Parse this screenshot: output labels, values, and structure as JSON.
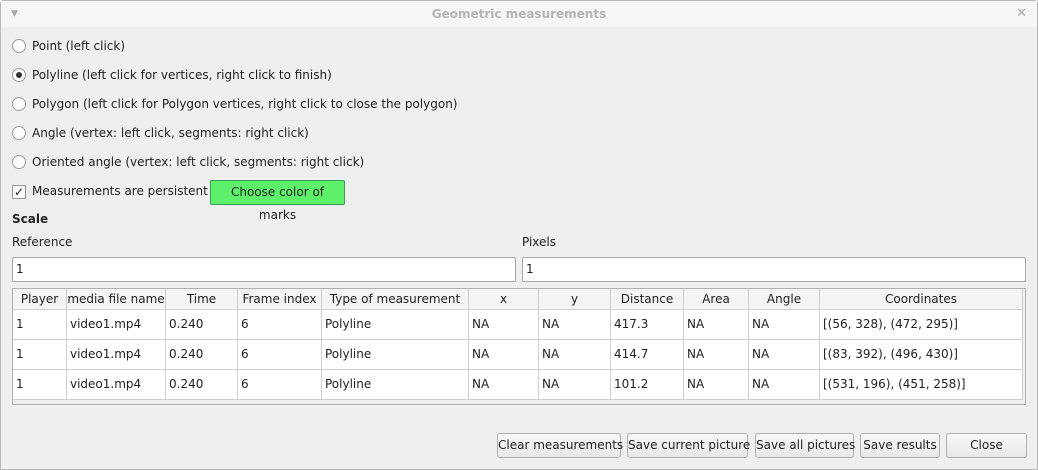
{
  "window": {
    "title": "Geometric measurements",
    "menu_icon": "triangle-down-icon",
    "close_icon": "close-icon"
  },
  "modes": [
    {
      "label": "Point (left click)",
      "checked": false
    },
    {
      "label": "Polyline (left click for vertices, right click to finish)",
      "checked": true
    },
    {
      "label": "Polygon (left click for Polygon vertices, right click to close the polygon)",
      "checked": false
    },
    {
      "label": "Angle (vertex: left click, segments: right click)",
      "checked": false
    },
    {
      "label": "Oriented angle (vertex: left click, segments: right click)",
      "checked": false
    }
  ],
  "persistent": {
    "label": "Measurements are persistent",
    "checked": true
  },
  "color_button": {
    "label": "Choose color of marks",
    "color": "#5ef06b"
  },
  "scale": {
    "title": "Scale",
    "reference_label": "Reference",
    "reference_value": "1",
    "pixels_label": "Pixels",
    "pixels_value": "1"
  },
  "table": {
    "columns": [
      "Player",
      "media file name",
      "Time",
      "Frame index",
      "Type of measurement",
      "x",
      "y",
      "Distance",
      "Area",
      "Angle",
      "Coordinates"
    ],
    "rows": [
      [
        "1",
        "video1.mp4",
        "0.240",
        "6",
        "Polyline",
        "NA",
        "NA",
        "417.3",
        "NA",
        "NA",
        "[(56, 328), (472, 295)]"
      ],
      [
        "1",
        "video1.mp4",
        "0.240",
        "6",
        "Polyline",
        "NA",
        "NA",
        "414.7",
        "NA",
        "NA",
        "[(83, 392), (496, 430)]"
      ],
      [
        "1",
        "video1.mp4",
        "0.240",
        "6",
        "Polyline",
        "NA",
        "NA",
        "101.2",
        "NA",
        "NA",
        "[(531, 196), (451, 258)]"
      ]
    ]
  },
  "buttons": {
    "clear": "Clear measurements",
    "save_current": "Save current picture",
    "save_all": "Save all pictures",
    "save_results": "Save results",
    "close": "Close"
  }
}
